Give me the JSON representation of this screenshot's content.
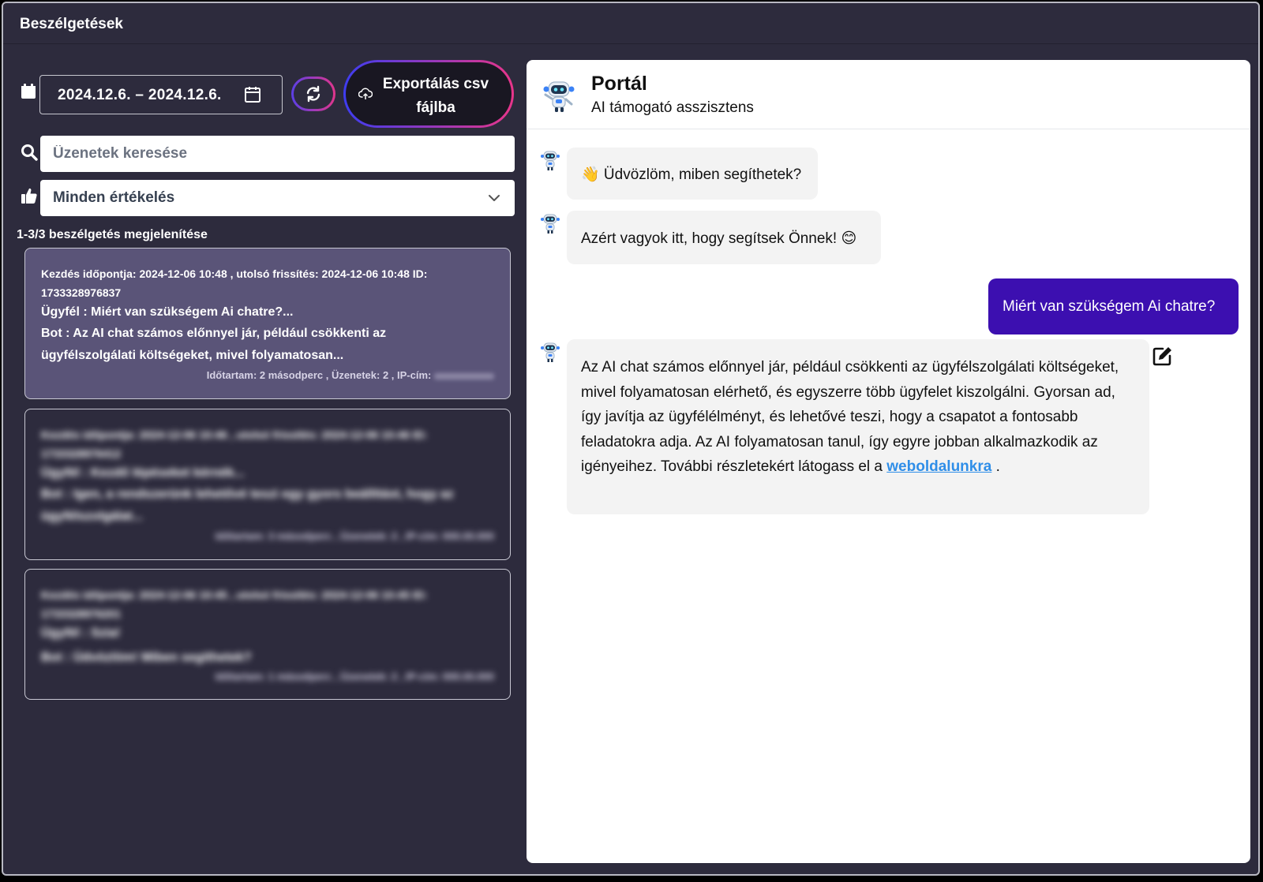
{
  "header": {
    "title": "Beszélgetések"
  },
  "filters": {
    "date_range": "2024.12.6. – 2024.12.6.",
    "export_label": "Exportálás csv fájlba",
    "search_placeholder": "Üzenetek keresése",
    "rating_value": "Minden értékelés",
    "count_text": "1-3/3 beszélgetés megjelenítése"
  },
  "conversations": [
    {
      "meta": "Kezdés időpontja: 2024-12-06 10:48 , utolsó frissítés: 2024-12-06 10:48 ID: 1733328976837",
      "client": "Ügyfél :  Miért van szükségem Ai chatre?...",
      "bot": "Bot :  Az AI chat számos előnnyel jár, például csökkenti az ügyfélszolgálati költségeket, mivel folyamatosan...",
      "stats": "Időtartam: 2 másodperc , Üzenetek: 2 , IP-cím:"
    }
  ],
  "blurred_conversations": [
    {
      "meta": "Kezdés időpontja: 2024-12-06 10:46 , utolsó frissítés: 2024-12-06 10:46 ID: 1733328976412",
      "client": "Ügyfél :  Kezdő lépéseket kérnék...",
      "bot": "Bot :  Igen, a rendszerünk lehetővé teszi egy gyors beállítást, hogy az ügyfélszolgálat...",
      "stats": "Időtartam: 3 másodperc , Üzenetek: 2 , IP-cím: 000.00.000"
    },
    {
      "meta": "Kezdés időpontja: 2024-12-06 10:45 , utolsó frissítés: 2024-12-06 10:45 ID: 1733328976201",
      "client": "Ügyfél :  Szia!",
      "bot": "Bot :  Üdvözlöm! Miben segíthetek?",
      "stats": "Időtartam: 1 másodperc , Üzenetek: 2 , IP-cím: 000.00.000"
    }
  ],
  "chat": {
    "name": "Portál",
    "subtitle": "AI támogató asszisztens",
    "msg1": "👋 Üdvözlöm, miben segíthetek?",
    "msg2": "Azért vagyok itt, hogy segítsek Önnek! 😊",
    "user_msg": "Miért van szükségem Ai chatre?",
    "msg3": "Az AI chat számos előnnyel jár, például csökkenti az ügyfélszolgálati költségeket, mivel folyamatosan elérhető, és egyszerre több ügyfelet kiszolgálni. Gyorsan ad, így javítja az ügyfélélményt, és lehetővé teszi, hogy a csapatot a fontosabb feladatokra adja. Az AI folyamatosan tanul, így egyre jobban alkalmazkodik az igényeihez. További részletekért látogass el a",
    "msg3_link": "weboldalunkra",
    "msg3_end": "."
  },
  "colors": {
    "accent_purple": "#3c0fb0",
    "panel_bg": "#2d2b3d",
    "link": "#2f8ee8"
  },
  "icons": [
    "calendar-icon",
    "refresh-icon",
    "cloud-upload-icon",
    "search-icon",
    "thumbs-up-icon",
    "chevron-down-icon",
    "robot-avatar-icon",
    "edit-icon"
  ]
}
